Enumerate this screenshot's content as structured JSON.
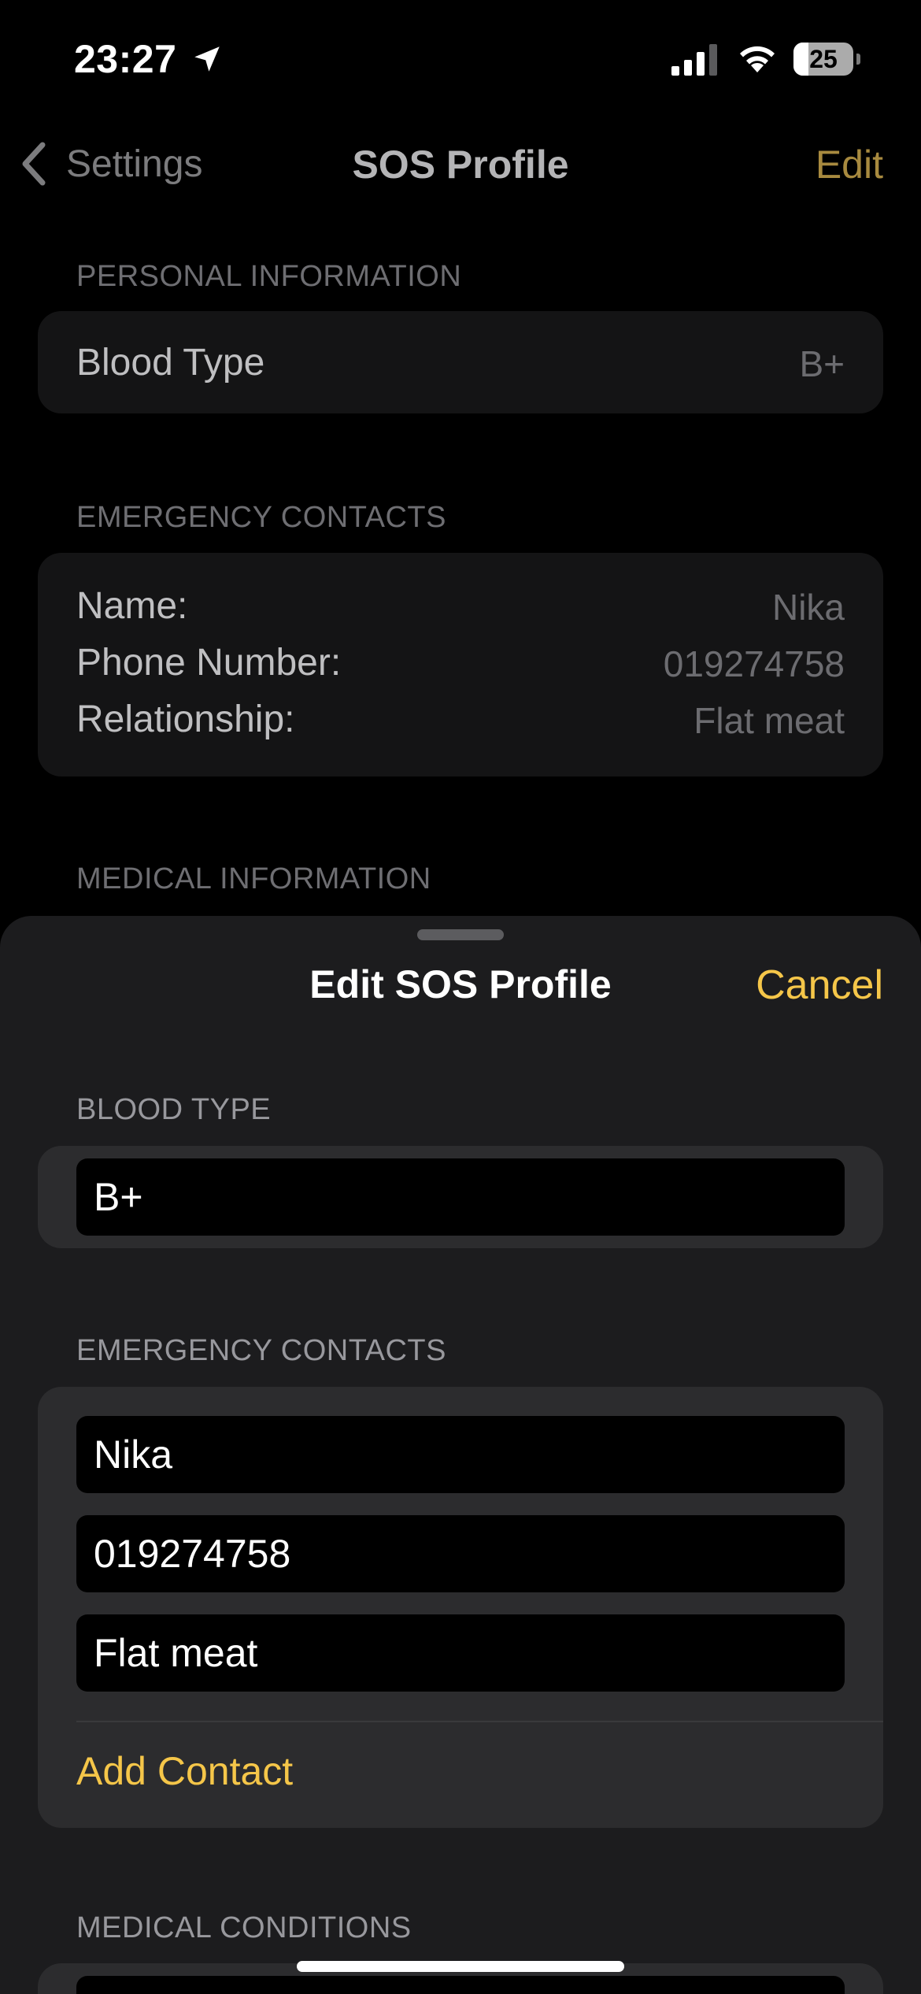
{
  "status_bar": {
    "time": "23:27",
    "battery_level": "25",
    "battery_percent": 25,
    "icons": [
      "location-arrow-icon",
      "cellular-signal-icon",
      "wifi-icon",
      "battery-icon"
    ]
  },
  "nav": {
    "back_label": "Settings",
    "title": "SOS Profile",
    "edit_label": "Edit",
    "back_icon": "chevron-left-icon"
  },
  "background_page": {
    "personal_header": "PERSONAL INFORMATION",
    "blood_type_label": "Blood Type",
    "blood_type_value": "B+",
    "contacts_header": "EMERGENCY CONTACTS",
    "contact_rows": [
      {
        "label": "Name:",
        "value": "Nika"
      },
      {
        "label": "Phone Number:",
        "value": "019274758"
      },
      {
        "label": "Relationship:",
        "value": "Flat meat"
      }
    ],
    "medical_header": "MEDICAL INFORMATION"
  },
  "sheet": {
    "title": "Edit SOS Profile",
    "cancel_label": "Cancel",
    "blood_type_header": "BLOOD TYPE",
    "blood_type_value": "B+",
    "contacts_header": "EMERGENCY CONTACTS",
    "contact_name_value": "Nika",
    "contact_phone_value": "019274758",
    "contact_relationship_value": "Flat meat",
    "add_contact_label": "Add Contact",
    "medical_conditions_header": "MEDICAL CONDITIONS"
  },
  "colors": {
    "accent": "#f5c649",
    "accent_dimmed": "#a88a3f",
    "sheet_background": "#1c1c1e",
    "card_background": "#2c2c2e",
    "field_background": "#000000"
  }
}
